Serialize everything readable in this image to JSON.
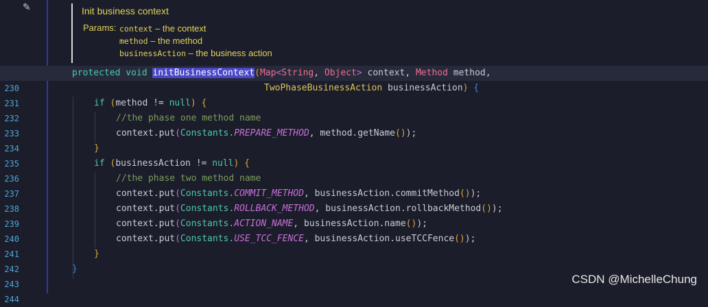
{
  "doc": {
    "title": "Init business context",
    "params_label": "Params:",
    "params": [
      {
        "name": "context",
        "desc": " – the context"
      },
      {
        "name": "method",
        "desc": " – the method"
      },
      {
        "name": "businessAction",
        "desc": " – the business action"
      }
    ]
  },
  "lines": [
    {
      "num": "230"
    },
    {
      "num": "231"
    },
    {
      "num": "232"
    },
    {
      "num": "233"
    },
    {
      "num": "234"
    },
    {
      "num": "235"
    },
    {
      "num": "236"
    },
    {
      "num": "237"
    },
    {
      "num": "238"
    },
    {
      "num": "239"
    },
    {
      "num": "240"
    },
    {
      "num": "241"
    },
    {
      "num": "242"
    },
    {
      "num": "243"
    },
    {
      "num": "244"
    }
  ],
  "code": {
    "l230": {
      "protected": "protected",
      "void": "void",
      "method_name": "initBusinessContext",
      "p1": "(",
      "map": "Map",
      "lt": "<",
      "string": "String",
      "comma1": ", ",
      "object": "Object",
      "gt": ">",
      "context": " context, ",
      "method_type": "Method",
      "method": " method,"
    },
    "l231": {
      "tpba": "TwoPhaseBusinessAction",
      "ba": " businessAction",
      "close": ")",
      "brace": " {"
    },
    "l232": {
      "if": "if",
      "open": " (",
      "expr": "method != ",
      "null": "null",
      "close": ")",
      "brace": " {"
    },
    "l233": {
      "comment": "//the phase one method name"
    },
    "l234": {
      "ctx": "context.put",
      "p1": "(",
      "cls": "Constants.",
      "const": "PREPARE_METHOD",
      "rest": ", method.getName",
      "p2": "()",
      "end": ");"
    },
    "l235": {
      "brace": "}"
    },
    "l236": {
      "if": "if",
      "open": " (",
      "expr": "businessAction != ",
      "null": "null",
      "close": ")",
      "brace": " {"
    },
    "l237": {
      "comment": "//the phase two method name"
    },
    "l238": {
      "ctx": "context.put",
      "p1": "(",
      "cls": "Constants.",
      "const": "COMMIT_METHOD",
      "rest": ", businessAction.commitMethod",
      "p2": "()",
      "end": ");"
    },
    "l239": {
      "ctx": "context.put",
      "p1": "(",
      "cls": "Constants.",
      "const": "ROLLBACK_METHOD",
      "rest": ", businessAction.rollbackMethod",
      "p2": "()",
      "end": ");"
    },
    "l240": {
      "ctx": "context.put",
      "p1": "(",
      "cls": "Constants.",
      "const": "ACTION_NAME",
      "rest": ", businessAction.name",
      "p2": "()",
      "end": ");"
    },
    "l241": {
      "ctx": "context.put",
      "p1": "(",
      "cls": "Constants.",
      "const": "USE_TCC_FENCE",
      "rest": ", businessAction.useTCCFence",
      "p2": "()",
      "end": ");"
    },
    "l242": {
      "brace": "}"
    },
    "l243": {
      "brace": "}"
    }
  },
  "watermark": "CSDN @MichelleChung",
  "icons": {
    "edit": "pencil-icon"
  }
}
